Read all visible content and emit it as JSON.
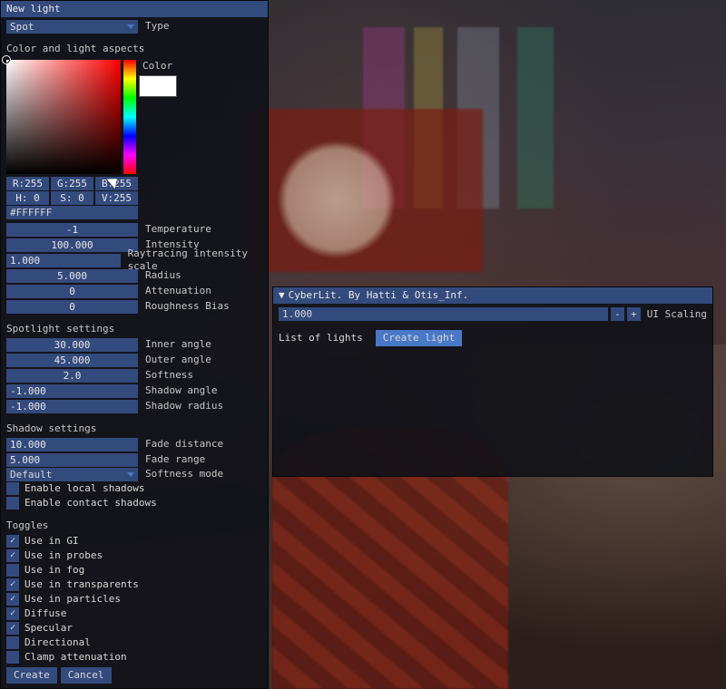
{
  "leftPanel": {
    "title": "New light",
    "type": {
      "value": "Spot",
      "label": "Type"
    },
    "colorSection": {
      "heading": "Color and light aspects",
      "colorLabel": "Color",
      "rgb": {
        "r": "R:255",
        "g": "G:255",
        "b": "B:255"
      },
      "hsv": {
        "h": "H: 0",
        "s": "S: 0",
        "v": "V:255"
      },
      "hex": "#FFFFFF",
      "swatchHex": "#FFFFFF"
    },
    "numeric": [
      {
        "value": "-1",
        "label": "Temperature"
      },
      {
        "value": "100.000",
        "label": "Intensity"
      },
      {
        "value": "1.000",
        "label": "Raytracing intensity scale",
        "align": "left"
      },
      {
        "value": "5.000",
        "label": "Radius"
      },
      {
        "value": "0",
        "label": "Attenuation"
      },
      {
        "value": "0",
        "label": "Roughness Bias"
      }
    ],
    "spotlight": {
      "heading": "Spotlight settings",
      "rows": [
        {
          "value": "30.000",
          "label": "Inner angle"
        },
        {
          "value": "45.000",
          "label": "Outer angle"
        },
        {
          "value": "2.0",
          "label": "Softness"
        },
        {
          "value": "-1.000",
          "label": "Shadow angle",
          "align": "left"
        },
        {
          "value": "-1.000",
          "label": "Shadow radius",
          "align": "left"
        }
      ]
    },
    "shadow": {
      "heading": "Shadow settings",
      "rows": [
        {
          "value": "10.000",
          "label": "Fade distance",
          "align": "left"
        },
        {
          "value": "5.000",
          "label": "Fade range",
          "align": "left"
        }
      ],
      "softnessMode": {
        "value": "Default",
        "label": "Softness mode"
      },
      "checks": [
        {
          "checked": false,
          "label": "Enable local shadows"
        },
        {
          "checked": false,
          "label": "Enable contact shadows"
        }
      ]
    },
    "toggles": {
      "heading": "Toggles",
      "items": [
        {
          "checked": true,
          "label": "Use in GI"
        },
        {
          "checked": true,
          "label": "Use in probes"
        },
        {
          "checked": false,
          "label": "Use in fog"
        },
        {
          "checked": true,
          "label": "Use in transparents"
        },
        {
          "checked": true,
          "label": "Use in particles"
        },
        {
          "checked": true,
          "label": "Diffuse"
        },
        {
          "checked": true,
          "label": "Specular"
        },
        {
          "checked": false,
          "label": "Directional"
        },
        {
          "checked": false,
          "label": "Clamp attenuation"
        }
      ]
    },
    "buttons": {
      "create": "Create",
      "cancel": "Cancel"
    }
  },
  "rightPanel": {
    "title": "CyberLit. By Hatti & Otis_Inf.",
    "uiScaling": {
      "value": "1.000",
      "minus": "-",
      "plus": "+",
      "label": "UI Scaling"
    },
    "listLabel": "List of lights",
    "createLight": "Create light"
  }
}
